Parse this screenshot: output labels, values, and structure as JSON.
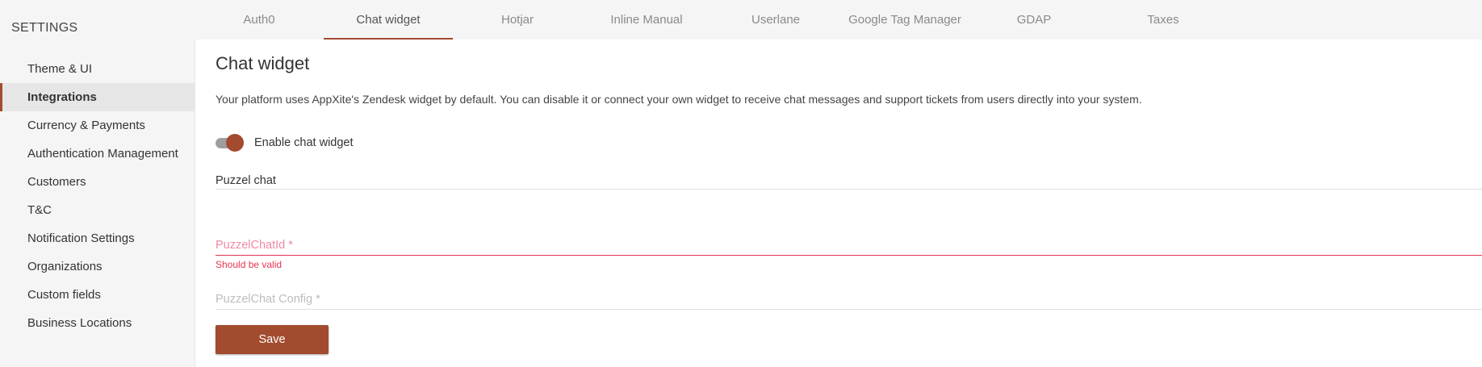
{
  "sidebar": {
    "title": "SETTINGS",
    "items": [
      {
        "label": "Theme & UI"
      },
      {
        "label": "Integrations"
      },
      {
        "label": "Currency & Payments"
      },
      {
        "label": "Authentication Management"
      },
      {
        "label": "Customers"
      },
      {
        "label": "T&C"
      },
      {
        "label": "Notification Settings"
      },
      {
        "label": "Organizations"
      },
      {
        "label": "Custom fields"
      },
      {
        "label": "Business Locations"
      }
    ],
    "active_item": "Integrations"
  },
  "tabs": [
    {
      "label": "Auth0"
    },
    {
      "label": "Chat widget"
    },
    {
      "label": "Hotjar"
    },
    {
      "label": "Inline Manual"
    },
    {
      "label": "Userlane"
    },
    {
      "label": "Google Tag Manager"
    },
    {
      "label": "GDAP"
    },
    {
      "label": "Taxes"
    }
  ],
  "active_tab": "Chat widget",
  "main": {
    "title": "Chat widget",
    "description": "Your platform uses AppXite's Zendesk widget by default. You can disable it or connect your own widget to receive chat messages and support tickets from users directly into your system.",
    "toggle": {
      "label": "Enable chat widget",
      "state": "on"
    },
    "section_label": "Puzzel chat",
    "fields": {
      "chat_id": {
        "placeholder": "PuzzelChatId *",
        "value": "",
        "error": "Should be valid"
      },
      "chat_config": {
        "placeholder": "PuzzelChat Config *",
        "value": ""
      }
    },
    "save_label": "Save"
  },
  "colors": {
    "accent": "#a34b2f",
    "error": "#e53554",
    "sidebar_bg": "#f5f5f5",
    "content_bg": "#ffffff"
  }
}
